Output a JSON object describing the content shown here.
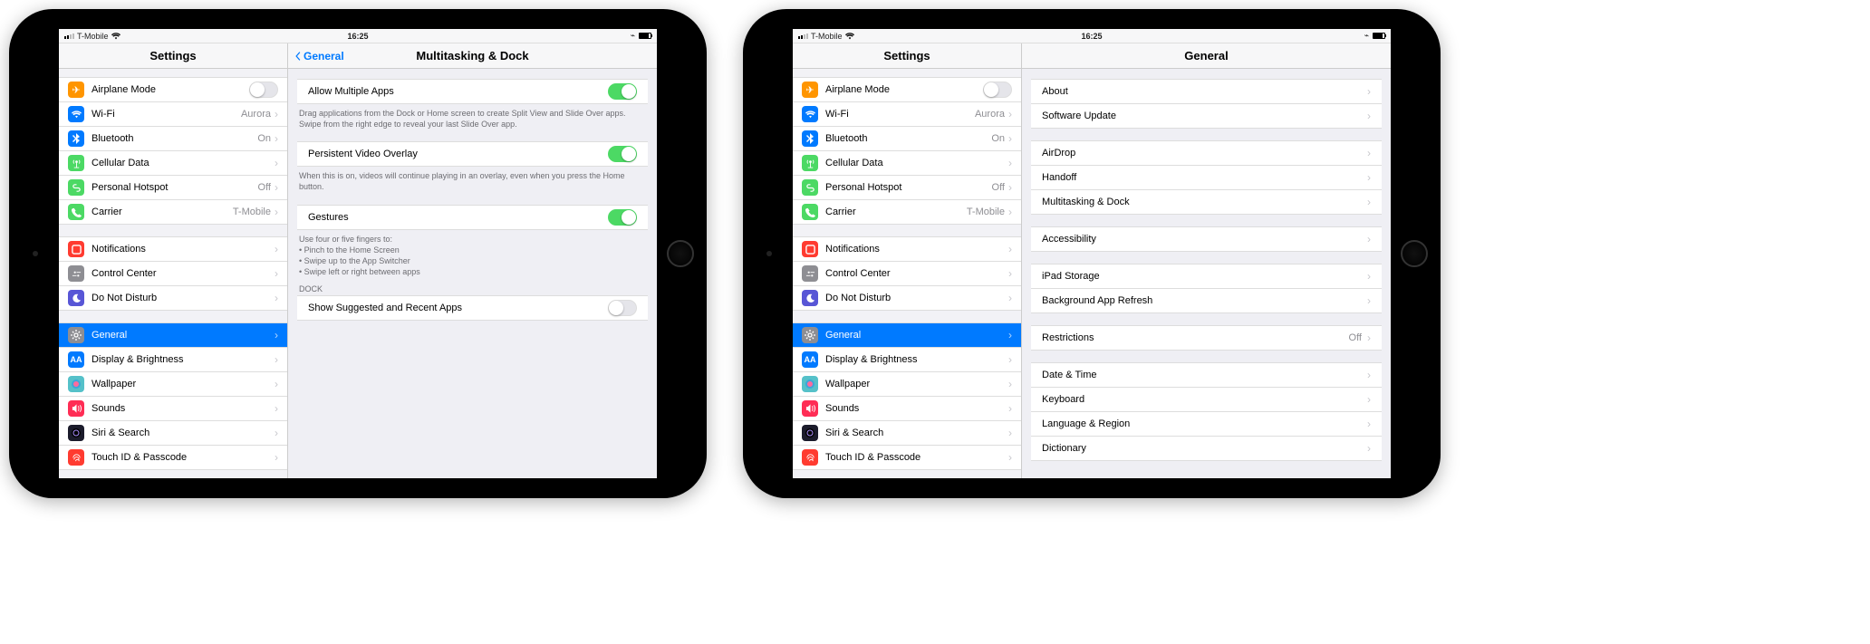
{
  "status": {
    "carrier": "T-Mobile",
    "time": "16:25"
  },
  "settings_title": "Settings",
  "sidebar": [
    {
      "id": "airplane",
      "label": "Airplane Mode",
      "color": "#ff9500",
      "glyph": "✈",
      "toggle": false
    },
    {
      "id": "wifi",
      "label": "Wi-Fi",
      "color": "#007aff",
      "glyph": "wifi",
      "value": "Aurora",
      "chev": true
    },
    {
      "id": "bluetooth",
      "label": "Bluetooth",
      "color": "#007aff",
      "glyph": "bt",
      "value": "On",
      "chev": true
    },
    {
      "id": "cellular",
      "label": "Cellular Data",
      "color": "#4cd964",
      "glyph": "ant",
      "chev": true
    },
    {
      "id": "hotspot",
      "label": "Personal Hotspot",
      "color": "#4cd964",
      "glyph": "link",
      "value": "Off",
      "chev": true
    },
    {
      "id": "carrier",
      "label": "Carrier",
      "color": "#4cd964",
      "glyph": "phone",
      "value": "T-Mobile",
      "chev": true
    }
  ],
  "sidebar2": [
    {
      "id": "notifications",
      "label": "Notifications",
      "color": "#ff3b30",
      "glyph": "bell",
      "chev": true
    },
    {
      "id": "controlcenter",
      "label": "Control Center",
      "color": "#8e8e93",
      "glyph": "cc",
      "chev": true
    },
    {
      "id": "dnd",
      "label": "Do Not Disturb",
      "color": "#5856d6",
      "glyph": "moon",
      "chev": true
    }
  ],
  "sidebar3": [
    {
      "id": "general",
      "label": "General",
      "color": "#8e8e93",
      "glyph": "gear",
      "selected": true,
      "chev": true
    },
    {
      "id": "display",
      "label": "Display & Brightness",
      "color": "#007aff",
      "glyph": "AA",
      "chev": true
    },
    {
      "id": "wallpaper",
      "label": "Wallpaper",
      "color": "#55c1c9",
      "glyph": "wp",
      "chev": true
    },
    {
      "id": "sounds",
      "label": "Sounds",
      "color": "#ff2d55",
      "glyph": "snd",
      "chev": true
    },
    {
      "id": "siri",
      "label": "Siri & Search",
      "color": "#1b1b2b",
      "glyph": "siri",
      "chev": true
    },
    {
      "id": "touchid",
      "label": "Touch ID & Passcode",
      "color": "#ff3b30",
      "glyph": "fp",
      "chev": true
    }
  ],
  "left_detail": {
    "back_label": "General",
    "title": "Multitasking & Dock",
    "group1": [
      {
        "label": "Allow Multiple Apps",
        "on": true
      }
    ],
    "note1": "Drag applications from the Dock or Home screen to create Split View and Slide Over apps. Swipe from the right edge to reveal your last Slide Over app.",
    "group2": [
      {
        "label": "Persistent Video Overlay",
        "on": true
      }
    ],
    "note2": "When this is on, videos will continue playing in an overlay, even when you press the Home button.",
    "group3": [
      {
        "label": "Gestures",
        "on": true
      }
    ],
    "note3_lead": "Use four or five fingers to:",
    "note3_lines": [
      "• Pinch to the Home Screen",
      "• Swipe up to the App Switcher",
      "• Swipe left or right between apps"
    ],
    "dock_header": "DOCK",
    "group4": [
      {
        "label": "Show Suggested and Recent Apps",
        "on": false
      }
    ]
  },
  "right_detail": {
    "title": "General",
    "groups": [
      [
        {
          "label": "About"
        },
        {
          "label": "Software Update"
        }
      ],
      [
        {
          "label": "AirDrop"
        },
        {
          "label": "Handoff"
        },
        {
          "label": "Multitasking & Dock"
        }
      ],
      [
        {
          "label": "Accessibility"
        }
      ],
      [
        {
          "label": "iPad Storage"
        },
        {
          "label": "Background App Refresh"
        }
      ],
      [
        {
          "label": "Restrictions",
          "value": "Off"
        }
      ],
      [
        {
          "label": "Date & Time"
        },
        {
          "label": "Keyboard"
        },
        {
          "label": "Language & Region"
        },
        {
          "label": "Dictionary"
        }
      ]
    ]
  },
  "icon_colors": {}
}
